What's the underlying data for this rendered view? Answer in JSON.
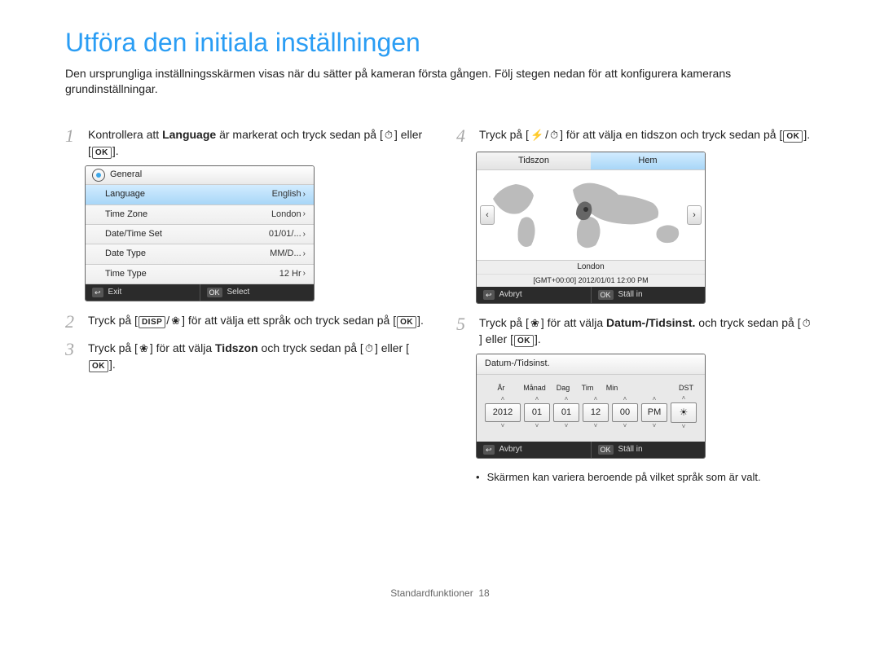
{
  "page": {
    "title": "Utföra den initiala inställningen",
    "intro": "Den ursprungliga inställningsskärmen visas när du sätter på kameran första gången. Följ stegen nedan för att konfigurera kamerans grundinställningar.",
    "footer_section": "Standardfunktioner",
    "footer_page": "18"
  },
  "icons": {
    "ok": "OK",
    "disp": "DISP",
    "flower": "❀",
    "flash": "⚡",
    "timer": "⏱",
    "back": "↩"
  },
  "steps": {
    "s1a": "Kontrollera att ",
    "s1b": "Language",
    "s1c": " är markerat och tryck sedan på [",
    "s1d": "] eller [",
    "s1e": "].",
    "s2a": "Tryck på [",
    "s2b": "/",
    "s2c": "] för att välja ett språk och tryck sedan på [",
    "s2d": "].",
    "s3a": "Tryck på [",
    "s3b": "] för att välja ",
    "s3c": "Tidszon",
    "s3d": " och tryck sedan på [",
    "s3e": "] eller [",
    "s3f": "].",
    "s4a": "Tryck på [",
    "s4b": "/",
    "s4c": "] för att välja en tidszon och tryck sedan på [",
    "s4d": "].",
    "s5a": "Tryck på [",
    "s5b": "] för att välja ",
    "s5c": "Datum-/Tidsinst.",
    "s5d": " och tryck sedan på [",
    "s5e": "] eller [",
    "s5f": "]."
  },
  "general_panel": {
    "header": "General",
    "rows": [
      {
        "label": "Language",
        "value": "English",
        "selected": true
      },
      {
        "label": "Time Zone",
        "value": "London"
      },
      {
        "label": "Date/Time Set",
        "value": "01/01/..."
      },
      {
        "label": "Date Type",
        "value": "MM/D..."
      },
      {
        "label": "Time Type",
        "value": "12 Hr"
      }
    ],
    "footer_left": "Exit",
    "footer_right": "Select"
  },
  "tz_panel": {
    "tab1": "Tidszon",
    "tab2": "Hem",
    "city": "London",
    "gmt": "[GMT+00:00] 2012/01/01  12:00 PM",
    "footer_left": "Avbryt",
    "footer_right": "Ställ in"
  },
  "dt_panel": {
    "title": "Datum-/Tidsinst.",
    "labels": {
      "year": "År",
      "month": "Månad",
      "day": "Dag",
      "hour": "Tim",
      "min": "Min",
      "dst": "DST"
    },
    "values": {
      "year": "2012",
      "month": "01",
      "day": "01",
      "hour": "12",
      "min": "00",
      "ampm": "PM"
    },
    "footer_left": "Avbryt",
    "footer_right": "Ställ in"
  },
  "note": "Skärmen kan variera beroende på vilket språk som är valt."
}
